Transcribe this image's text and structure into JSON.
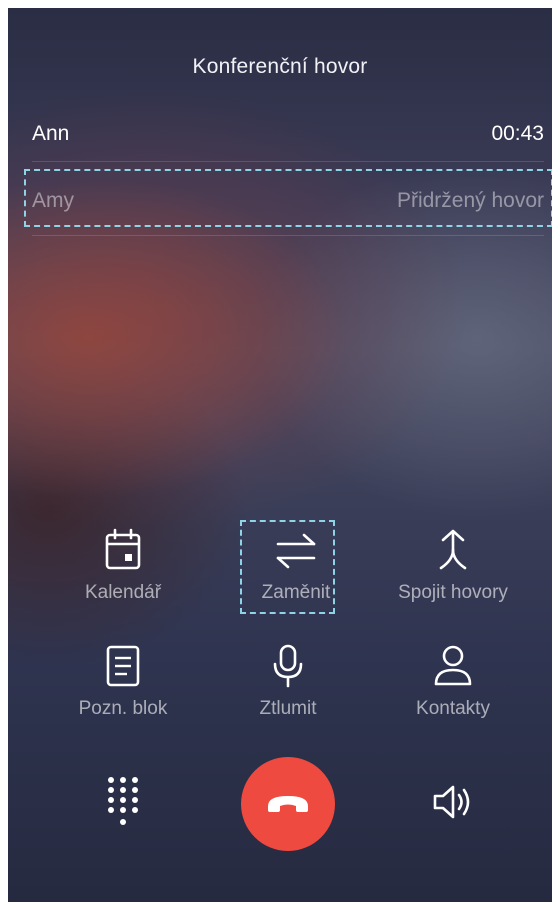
{
  "header": {
    "title": "Konferenční hovor"
  },
  "calls": [
    {
      "name": "Ann",
      "status": "00:43"
    },
    {
      "name": "Amy",
      "status": "Přidržený hovor"
    }
  ],
  "controls": [
    {
      "label": "Kalendář",
      "icon": "calendar-icon"
    },
    {
      "label": "Zaměnit",
      "icon": "swap-icon"
    },
    {
      "label": "Spojit hovory",
      "icon": "merge-icon"
    },
    {
      "label": "Pozn. blok",
      "icon": "notepad-icon"
    },
    {
      "label": "Ztlumit",
      "icon": "microphone-icon"
    },
    {
      "label": "Kontakty",
      "icon": "contact-icon"
    }
  ],
  "bottom": {
    "keypad_icon": "dialpad-icon",
    "hangup_icon": "end-call-icon",
    "speaker_icon": "speaker-icon"
  },
  "colors": {
    "hangup": "#ef4a3f",
    "highlight_box": "#8fd3e6"
  }
}
